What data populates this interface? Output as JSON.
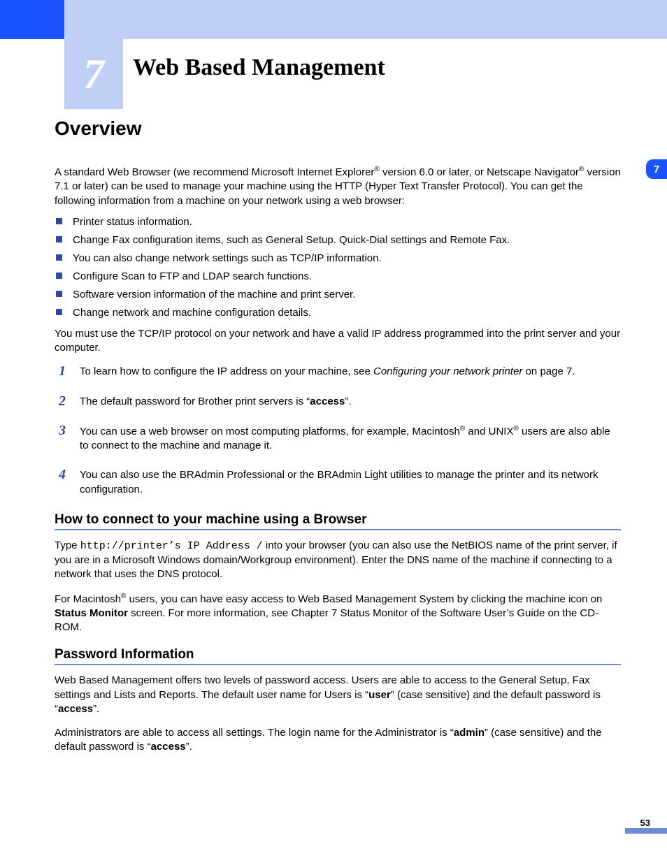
{
  "chapter": {
    "number": "7",
    "title": "Web Based Management",
    "side_tab": "7"
  },
  "overview": {
    "heading": "Overview",
    "intro_pre": "A standard Web Browser (we recommend Microsoft Internet Explorer",
    "intro_mid1": " version 6.0 or later, or Netscape Navigator",
    "intro_post": " version 7.1 or later) can be used to manage your machine using the HTTP (Hyper Text Transfer Protocol). You can get the following information from a machine on your network using a web browser:",
    "bullets": [
      "Printer status information.",
      "Change Fax configuration items, such as General Setup. Quick-Dial settings and Remote Fax.",
      "You can also change network settings such as TCP/IP information.",
      "Configure Scan to FTP and LDAP search functions.",
      "Software version information of the machine and print server.",
      "Change network and machine configuration details."
    ],
    "after_bullets": "You must use the TCP/IP protocol on your network and have a valid IP address programmed into the print server and your computer.",
    "notes": {
      "n1_pre": "To learn how to configure the IP address on your machine, see ",
      "n1_link": "Configuring your network printer",
      "n1_post": " on page 7.",
      "n2_pre": "The default password for Brother print servers is “",
      "n2_bold": "access",
      "n2_post": "”.",
      "n3_pre": "You can use a web browser on most computing platforms, for example, Macintosh",
      "n3_mid": " and UNIX",
      "n3_post": " users are also able to connect to the machine and manage it.",
      "n4": "You can also use the BRAdmin Professional or the BRAdmin Light utilities to manage the printer and its network configuration."
    }
  },
  "howto": {
    "heading": "How to connect to your machine using a Browser",
    "p1_pre": "Type ",
    "p1_code": "http://printer’s IP Address /",
    "p1_post": " into your browser (you can also use the NetBIOS name of the print server, if you are in a Microsoft Windows domain/Workgroup environment). Enter the DNS name of the machine if connecting to a network that uses the DNS protocol.",
    "p2_pre": "For Macintosh",
    "p2_mid": " users, you can have easy access to Web Based Management System by clicking the machine icon on ",
    "p2_bold": "Status Monitor",
    "p2_post": " screen. For more information, see Chapter 7 Status Monitor of the Software User’s Guide on the CD-ROM."
  },
  "password": {
    "heading": "Password Information",
    "p1_pre": "Web Based Management offers two levels of password access. Users are able to access to the General Setup, Fax settings and Lists and Reports. The default user name for Users is “",
    "p1_b1": "user",
    "p1_mid": "” (case sensitive) and the default password is “",
    "p1_b2": "access",
    "p1_post": "”.",
    "p2_pre": "Administrators are able to access all settings. The login name for the Administrator is “",
    "p2_b1": "admin",
    "p2_mid": "” (case sensitive) and the default password is “",
    "p2_b2": "access",
    "p2_post": "”."
  },
  "page_number": "53"
}
